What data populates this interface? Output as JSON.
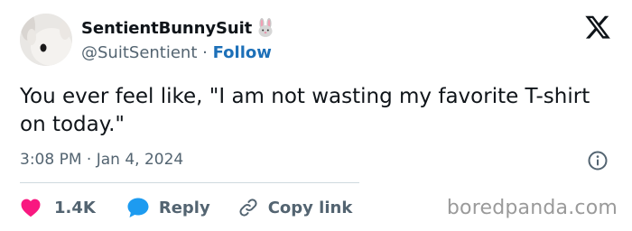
{
  "author": {
    "display_name": "SentientBunnySuit",
    "name_emoji": "rabbit-face-icon",
    "handle": "@SuitSentient",
    "separator": "·",
    "follow_label": "Follow"
  },
  "tweet": {
    "text": "You ever feel like, \"I am not wasting my favorite T-shirt on today.\"",
    "timestamp": "3:08 PM · Jan 4, 2024"
  },
  "actions": {
    "likes_count": "1.4K",
    "reply_label": "Reply",
    "copy_link_label": "Copy link"
  },
  "watermark": "boredpanda.com",
  "colors": {
    "like_red": "#f91880",
    "reply_blue": "#1d9bf0",
    "link_blue": "#1d70b8",
    "muted_gray": "#536471",
    "text_dark": "#0f1419"
  }
}
